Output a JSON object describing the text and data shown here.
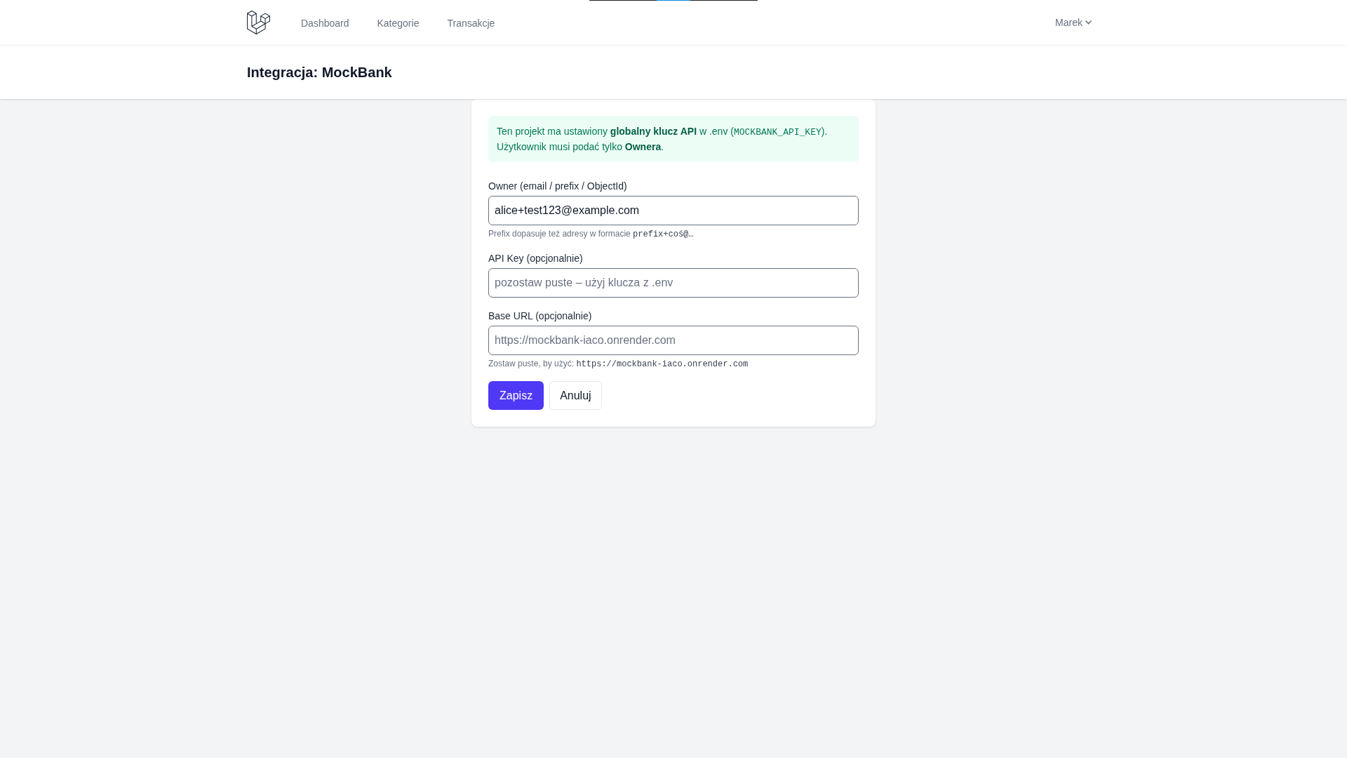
{
  "nav": {
    "links": [
      {
        "label": "Dashboard",
        "selected": false
      },
      {
        "label": "Kategorie",
        "selected": false
      },
      {
        "label": "Transakcje",
        "selected": false
      }
    ],
    "user_menu": {
      "label": "Marek"
    }
  },
  "header": {
    "title": "Integracja: MockBank"
  },
  "form": {
    "notice": {
      "parts": [
        {
          "kind": "text",
          "text": "Ten projekt ma ustawiony **globalny klucz API** w .env ("
        },
        {
          "kind": "code",
          "text": "MOCKBANK_API_KEY"
        },
        {
          "kind": "text",
          "text": "). Użytkownik musi podać tylko **Ownera**."
        }
      ]
    },
    "fields": [
      {
        "label": "Owner (email / prefix / ObjectId)",
        "value": "alice+test123@example.com",
        "hint": [
          {
            "kind": "text",
            "text": "Prefix dopasuje też adresy w formacie "
          },
          {
            "kind": "code",
            "text": "prefix+coś@…"
          }
        ]
      },
      {
        "label": "API Key (opcjonalnie)",
        "placeholder": "pozostaw puste – użyj klucza z .env"
      },
      {
        "label": "Base URL (opcjonalnie)",
        "placeholder": "https://mockbank-iaco.onrender.com",
        "hint": [
          {
            "kind": "text",
            "text": "Zostaw puste, by użyć: "
          },
          {
            "kind": "code",
            "text": "https://mockbank-iaco.onrender.com"
          }
        ]
      }
    ],
    "buttons": [
      {
        "label": "Zapisz",
        "kind": "submit"
      },
      {
        "label": "Anuluj",
        "kind": "cancel"
      }
    ]
  }
}
